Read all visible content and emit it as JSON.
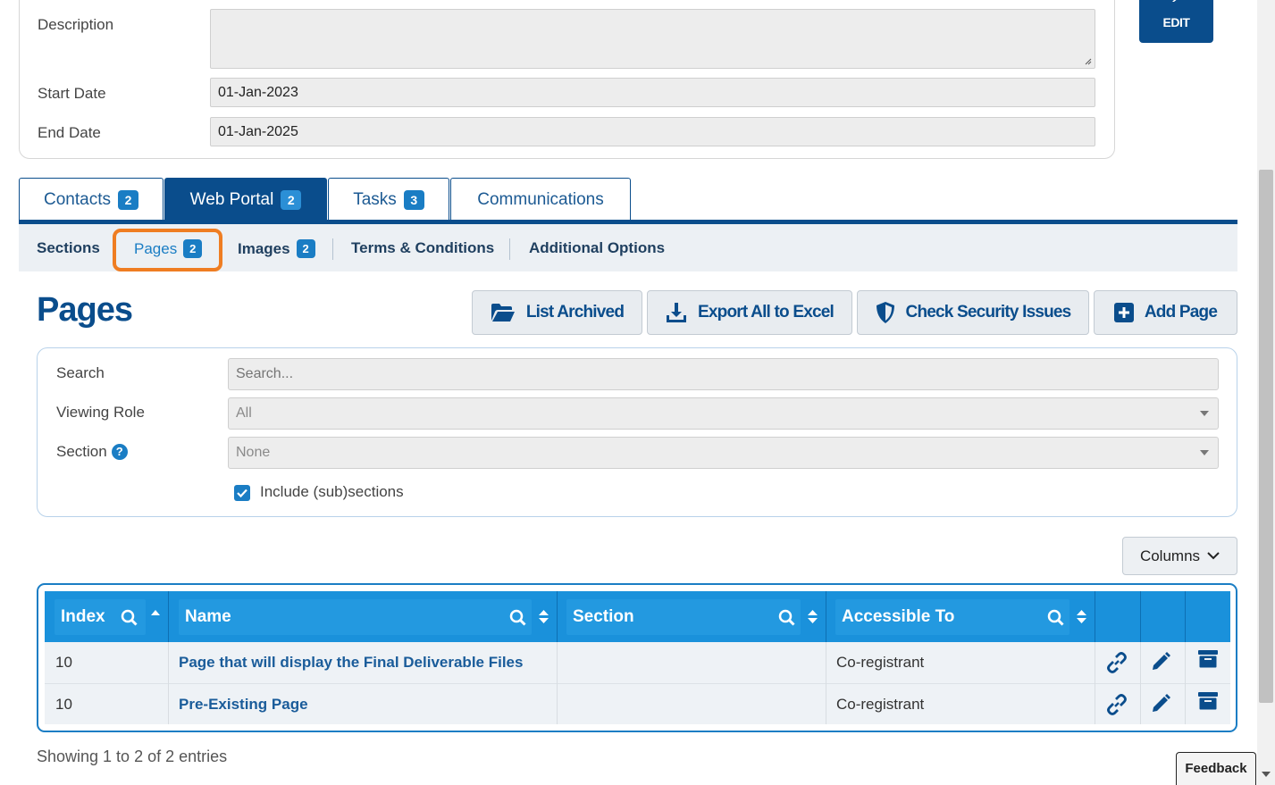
{
  "details": {
    "description_label": "Description",
    "description_value": "",
    "start_date_label": "Start Date",
    "start_date_value": "01-Jan-2023",
    "end_date_label": "End Date",
    "end_date_value": "01-Jan-2025",
    "edit_label": "EDIT"
  },
  "tabs": [
    {
      "label": "Contacts",
      "badge": "2"
    },
    {
      "label": "Web Portal",
      "badge": "2"
    },
    {
      "label": "Tasks",
      "badge": "3"
    },
    {
      "label": "Communications"
    }
  ],
  "subtabs": [
    {
      "label": "Sections"
    },
    {
      "label": "Pages",
      "badge": "2"
    },
    {
      "label": "Images",
      "badge": "2"
    },
    {
      "label": "Terms & Conditions"
    },
    {
      "label": "Additional Options"
    }
  ],
  "page_title": "Pages",
  "actions": {
    "list_archived": "List Archived",
    "export_excel": "Export All to Excel",
    "check_security": "Check Security Issues",
    "add_page": "Add Page"
  },
  "filters": {
    "search_label": "Search",
    "search_placeholder": "Search...",
    "viewing_role_label": "Viewing Role",
    "viewing_role_value": "All",
    "section_label": "Section",
    "section_help": "?",
    "section_value": "None",
    "include_sub_label": "Include (sub)sections",
    "include_sub_checked": true
  },
  "columns_button": "Columns",
  "table": {
    "headers": [
      "Index",
      "Name",
      "Section",
      "Accessible To"
    ],
    "rows": [
      {
        "index": "10",
        "name": "Page that will display the Final Deliverable Files",
        "section": "",
        "accessible_to": "Co-registrant"
      },
      {
        "index": "10",
        "name": "Pre-Existing Page",
        "section": "",
        "accessible_to": "Co-registrant"
      }
    ]
  },
  "showing_text": "Showing 1 to 2 of 2 entries",
  "feedback_label": "Feedback",
  "colors": {
    "primary": "#0a4d8c",
    "accent": "#1a7dc4",
    "highlight": "#ef7d22"
  }
}
